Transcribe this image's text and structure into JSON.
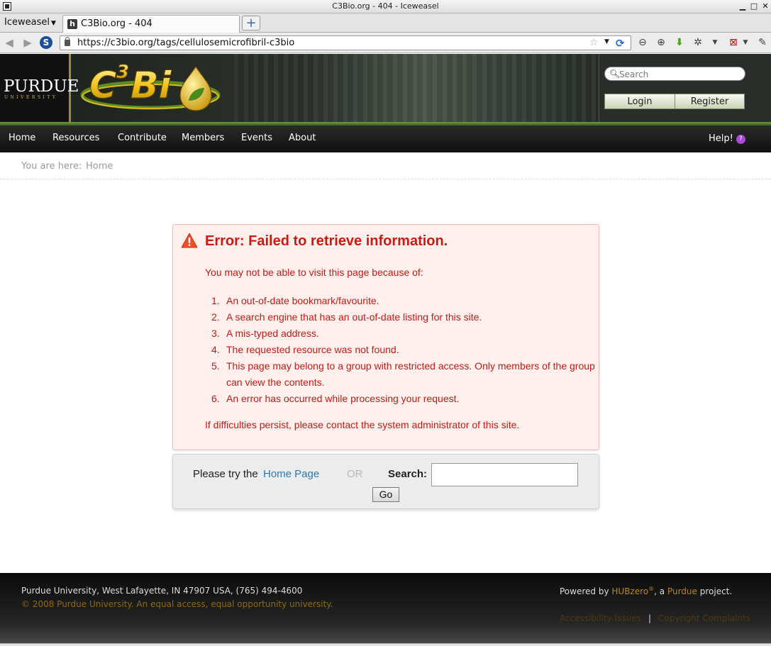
{
  "window": {
    "title": "C3Bio.org - 404 - Iceweasel",
    "minimize": "▁",
    "maximize": "□",
    "close": "✕"
  },
  "browser": {
    "app_menu": "Iceweasel",
    "tab": {
      "label": "C3Bio.org - 404",
      "favicon": "h"
    },
    "new_tab": "+",
    "url": "https://c3bio.org/tags/cellulosemicrofibril-c3bio"
  },
  "header": {
    "purdue": {
      "name": "PURDUE",
      "sub": "UNIVERSITY"
    },
    "logo_text": "C3Bio",
    "search_placeholder": "Search",
    "login": "Login",
    "register": "Register"
  },
  "nav": {
    "items": [
      "Home",
      "Resources",
      "Contribute",
      "Members",
      "Events",
      "About"
    ],
    "help": "Help!",
    "help_icon": "?"
  },
  "breadcrumb": {
    "prefix": "You are here:",
    "current": "Home"
  },
  "error": {
    "title": "Error: Failed to retrieve information.",
    "intro": "You may not be able to visit this page because of:",
    "reasons": [
      "An out-of-date bookmark/favourite.",
      "A search engine that has an out-of-date listing for this site.",
      "A mis-typed address.",
      "The requested resource was not found.",
      "This page may belong to a group with restricted access. Only members of the group can view the contents.",
      "An error has occurred while processing your request."
    ],
    "footer": "If difficulties persist, please contact the system administrator of this site."
  },
  "search_box": {
    "prefix": "Please try the",
    "home_link": "Home Page",
    "or": "OR",
    "label": "Search:",
    "value": "",
    "button": "Go"
  },
  "footer": {
    "address": "Purdue University, West Lafayette, IN 47907 USA, (765) 494-4600",
    "copyright": "© 2008 Purdue University. An equal access, equal opportunity university.",
    "powered_prefix": "Powered by",
    "powered_hub": "HUBzero",
    "powered_reg": "®",
    "powered_mid": ", a",
    "powered_purdue": "Purdue",
    "powered_suffix": "project.",
    "accessibility": "Accessibility Issues",
    "copyright_complaints": "Copyright Complaints"
  },
  "colors": {
    "error_text": "#c31a14",
    "error_bg": "#fff0ee",
    "link": "#2a7ab8",
    "footer_link": "#b8871c"
  }
}
